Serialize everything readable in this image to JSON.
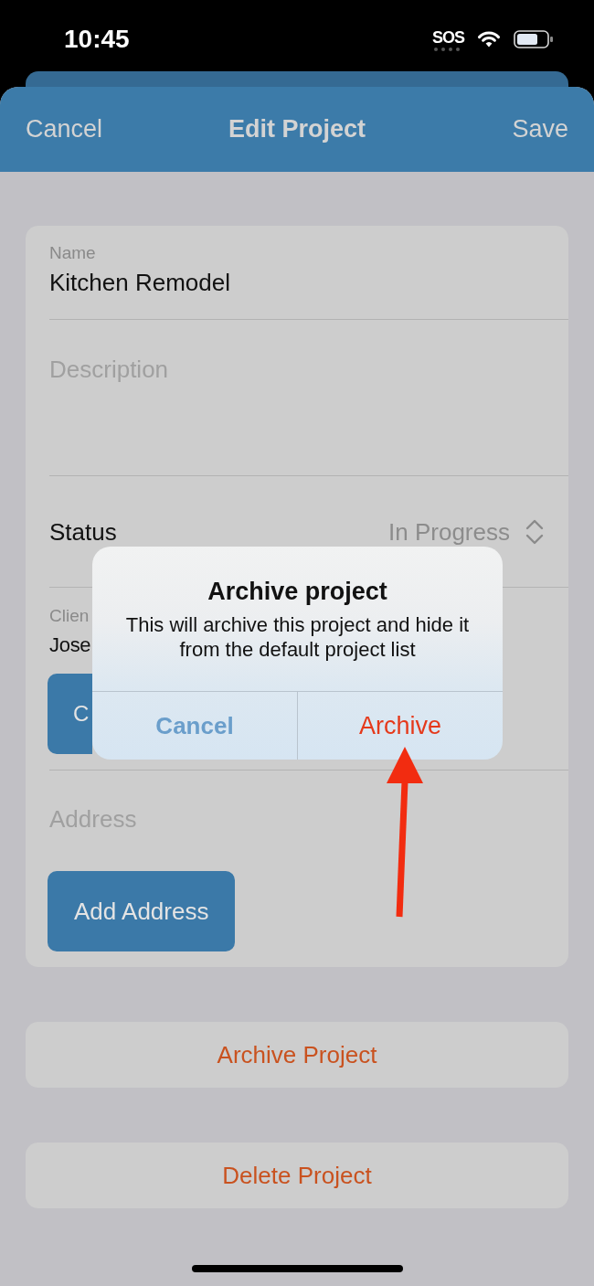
{
  "status_bar": {
    "time": "10:45",
    "carrier": "SOS"
  },
  "nav_bar": {
    "left_button": "Cancel",
    "title": "Edit Project",
    "right_button": "Save"
  },
  "form": {
    "fields": [
      {
        "kind": "text",
        "label": "Name",
        "value": "Kitchen Remodel"
      },
      {
        "kind": "textarea",
        "placeholder": "Description"
      },
      {
        "kind": "picker",
        "label": "Status",
        "value": "In Progress"
      },
      {
        "kind": "client",
        "label": "Clien",
        "value": "Jose",
        "button": "C"
      },
      {
        "kind": "address",
        "placeholder": "Address",
        "button": "Add Address"
      }
    ]
  },
  "actions": [
    "Archive Project",
    "Delete Project"
  ],
  "alert": {
    "title": "Archive project",
    "message": "This will archive this project and hide it from the default project list",
    "buttons": [
      {
        "kind": "cancel",
        "label": "Cancel"
      },
      {
        "kind": "destructive",
        "label": "Archive"
      }
    ]
  },
  "annotations": [
    {
      "kind": "arrow"
    }
  ]
}
